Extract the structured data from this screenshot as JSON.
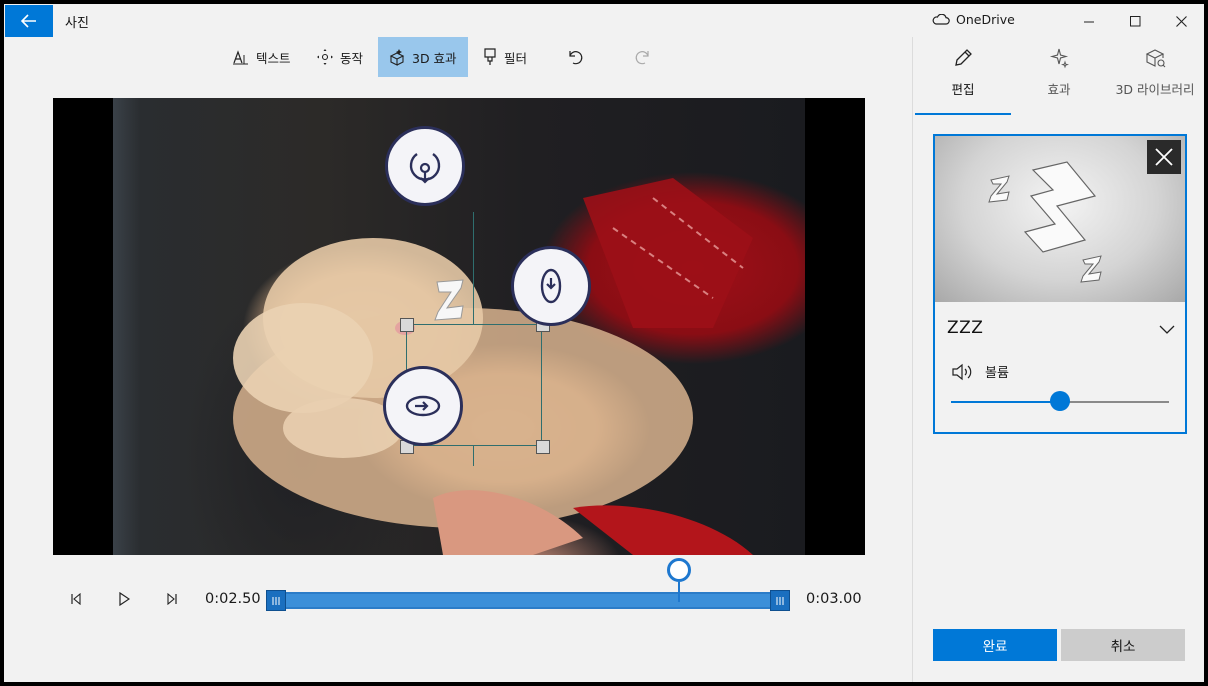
{
  "app": {
    "title": "사진",
    "onedrive_label": "OneDrive"
  },
  "toolbar": {
    "text_label": "텍스트",
    "motion_label": "동작",
    "effects3d_label": "3D 효과",
    "filter_label": "필터"
  },
  "canvas": {
    "effect_glyph": "Z"
  },
  "timeline": {
    "start_time": "0:02.50",
    "end_time": "0:03.00",
    "playhead_fraction": 0.8
  },
  "panel": {
    "tabs": [
      {
        "label": "편집",
        "icon": "pencil-icon",
        "active": true
      },
      {
        "label": "효과",
        "icon": "sparkle-icon",
        "active": false
      },
      {
        "label": "3D 라이브러리",
        "icon": "cube-icon",
        "active": false
      }
    ],
    "effect_name": "ZZZ",
    "volume_label": "볼륨",
    "volume_fraction": 0.5,
    "done_label": "완료",
    "cancel_label": "취소"
  },
  "colors": {
    "accent": "#0078d7",
    "active_tool": "#99c7ec",
    "track": "#3b8fd9"
  }
}
